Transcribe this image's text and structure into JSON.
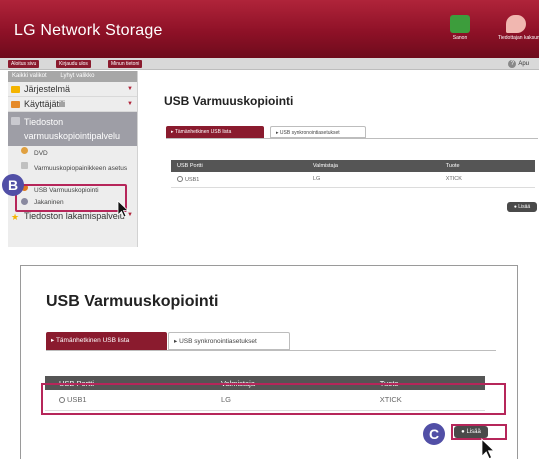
{
  "top": {
    "header": {
      "title": "LG Network Storage",
      "share_label": "Sanon",
      "notify_label": "Tiedottajan kaksumparanna"
    },
    "toolbar": {
      "home": "Aloitus sivu",
      "logout": "Kirjaudu ulos",
      "mine": "Minun tietoni",
      "help": "Apu"
    },
    "sidebar": {
      "tab_all": "Kaikki valikot",
      "tab_short": "Lyhyt valikko",
      "items": [
        "Järjestelmä",
        "Käyttäjätili"
      ],
      "selected": "Tiedoston varmuuskopiointipalvelu",
      "subitems": [
        "DVD",
        "Varmuuskopiopainikkeen asetus",
        "USB Varmuuskopiointi",
        "Jakaninen"
      ],
      "last": "Tiedoston lakamispalvelu"
    },
    "badge": "B",
    "main": {
      "title": "USB Varmuuskopiointi",
      "tab_list": "Tämänhetkinen USB lista",
      "tab_sync": "USB synkronointiasetukset",
      "columns": [
        "USB Portti",
        "Valmistaja",
        "Tuote"
      ],
      "row": {
        "port": "USB1",
        "maker": "LG",
        "product": "XTICK"
      },
      "add_label": "Lisää"
    }
  },
  "bottom": {
    "title": "USB Varmuuskopiointi",
    "tab_list": "Tämänhetkinen USB lista",
    "tab_sync": "USB synkronointiasetukset",
    "columns": [
      "USB Portti",
      "Valmistaja",
      "Tuote"
    ],
    "row": {
      "port": "USB1",
      "maker": "LG",
      "product": "XTICK"
    },
    "add_label": "Lisää",
    "badge": "C"
  },
  "colors": {
    "brand": "#8e1127",
    "highlight": "#b6265a",
    "badge": "#514fa6"
  }
}
